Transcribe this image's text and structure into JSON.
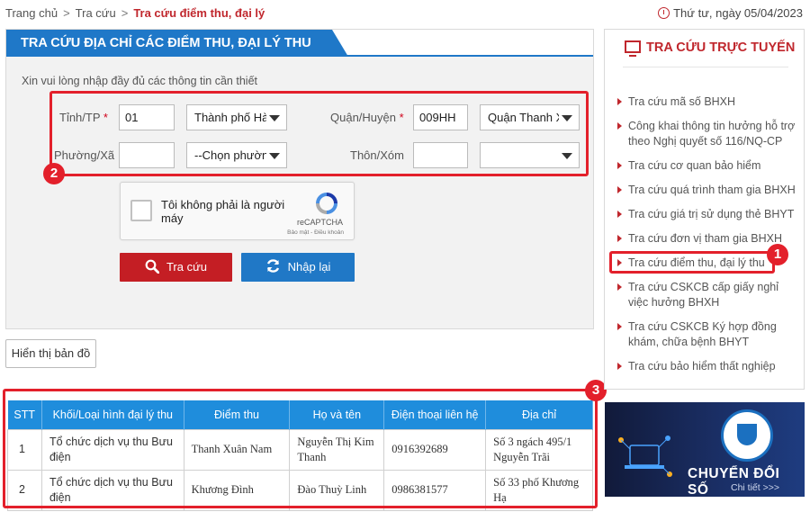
{
  "breadcrumb": {
    "home": "Trang chủ",
    "section": "Tra cứu",
    "current": "Tra cứu điểm thu, đại lý"
  },
  "date": "Thứ tư, ngày 05/04/2023",
  "form": {
    "header": "TRA CỨU ĐỊA CHỈ CÁC ĐIỂM THU, ĐẠI LÝ THU",
    "intro": "Xin vui lòng nhập đầy đủ các thông tin cần thiết",
    "province_label": "Tỉnh/TP",
    "province_code": "01",
    "province_select": "Thành phố Hà Nội",
    "district_label": "Quận/Huyện",
    "district_code": "009HH",
    "district_select": "Quận Thanh Xuân",
    "ward_label": "Phường/Xã",
    "ward_code": "",
    "ward_select": "--Chọn phường/xã--",
    "village_label": "Thôn/Xóm",
    "village_code": "",
    "village_select": "",
    "required_mark": "*",
    "captcha_text": "Tôi không phải là người máy",
    "captcha_brand": "reCAPTCHA",
    "captcha_terms": "Bảo mật - Điều khoản",
    "search_button": "Tra cứu",
    "reset_button": "Nhập lại"
  },
  "map_button": "Hiển thị bản đồ",
  "annotations": {
    "one": "1",
    "two": "2",
    "three": "3"
  },
  "table": {
    "headers": [
      "STT",
      "Khối/Loại hình đại lý thu",
      "Điểm thu",
      "Họ và tên",
      "Điện thoại liên hệ",
      "Địa chỉ"
    ],
    "rows": [
      [
        "1",
        "Tổ chức dịch vụ thu Bưu điện",
        "Thanh Xuân Nam",
        "Nguyễn Thị Kim Thanh",
        "0916392689",
        "Số 3 ngách 495/1 Nguyễn Trãi"
      ],
      [
        "2",
        "Tổ chức dịch vụ thu Bưu điện",
        "Khương Đình",
        "Đào Thuỳ Linh",
        "0986381577",
        "Số 33 phố Khương Hạ"
      ]
    ]
  },
  "sidebar": {
    "title": "TRA CỨU TRỰC TUYẾN",
    "items": [
      "Tra cứu mã số BHXH",
      "Công khai thông tin hưởng hỗ trợ theo Nghị quyết số 116/NQ-CP",
      "Tra cứu cơ quan bảo hiểm",
      "Tra cứu quá trình tham gia BHXH",
      "Tra cứu giá trị sử dụng thẻ BHYT",
      "Tra cứu đơn vị tham gia BHXH",
      "Tra cứu điểm thu, đại lý thu",
      "Tra cứu CSKCB cấp giấy nghỉ việc hưởng BHXH",
      "Tra cứu CSKCB Ký hợp đồng khám, chữa bệnh BHYT",
      "Tra cứu bảo hiểm thất nghiệp"
    ]
  },
  "banner": {
    "title": "CHUYỂN ĐỔI SỐ",
    "sub": "Chi tiết >>>"
  },
  "colors": {
    "brand_red": "#c0272d",
    "brand_blue": "#1f78c8",
    "annotation_red": "#e3202b"
  }
}
